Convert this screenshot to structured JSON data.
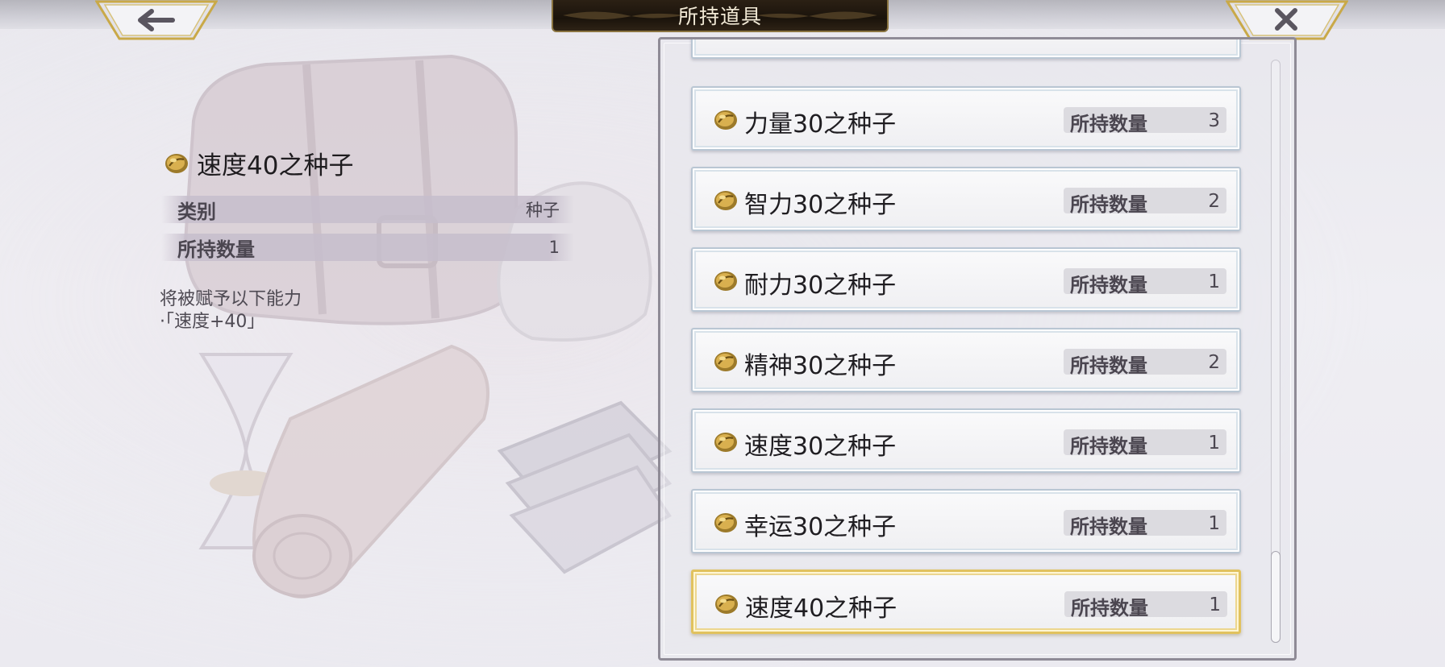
{
  "header": {
    "title": "所持道具",
    "back_icon": "arrow-left-icon",
    "close_icon": "close-icon"
  },
  "detail": {
    "name": "速度40之种子",
    "icon": "seed-icon",
    "rows": [
      {
        "label": "类别",
        "value": "种子"
      },
      {
        "label": "所持数量",
        "value": "1"
      }
    ],
    "description_line1": "将被赋予以下能力",
    "description_line2": "·「速度+40」"
  },
  "list": {
    "qty_label": "所持数量",
    "items": [
      {
        "name": "力量30之种子",
        "qty": "3",
        "selected": false
      },
      {
        "name": "智力30之种子",
        "qty": "2",
        "selected": false
      },
      {
        "name": "耐力30之种子",
        "qty": "1",
        "selected": false
      },
      {
        "name": "精神30之种子",
        "qty": "2",
        "selected": false
      },
      {
        "name": "速度30之种子",
        "qty": "1",
        "selected": false
      },
      {
        "name": "幸运30之种子",
        "qty": "1",
        "selected": false
      },
      {
        "name": "速度40之种子",
        "qty": "1",
        "selected": true
      }
    ]
  },
  "colors": {
    "gold_accent": "#e1c25e",
    "title_bg": "#1a130b",
    "text_dark": "#1e1c1f",
    "label_gray": "#4b4650"
  }
}
